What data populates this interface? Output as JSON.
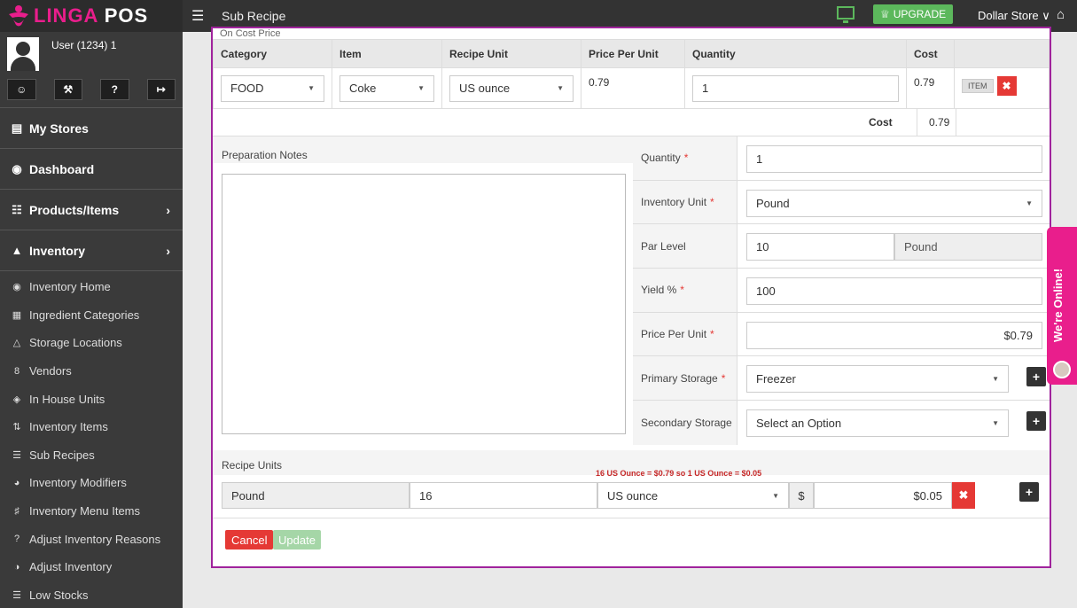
{
  "brand": {
    "logo_text_a": "LINGA",
    "logo_text_b": "POS"
  },
  "user": {
    "name": "User (1234) 1"
  },
  "user_icons": [
    "person-icon",
    "wrench-icon",
    "help-icon",
    "logout-icon"
  ],
  "nav": {
    "my_stores": "My Stores",
    "dashboard": "Dashboard",
    "products": "Products/Items",
    "inventory": "Inventory",
    "sub_items": [
      "Inventory Home",
      "Ingredient Categories",
      "Storage Locations",
      "Vendors",
      "In House Units",
      "Inventory Items",
      "Sub Recipes",
      "Inventory Modifiers",
      "Inventory Menu Items",
      "Adjust Inventory Reasons",
      "Adjust Inventory",
      "Low Stocks"
    ]
  },
  "topbar": {
    "title": "Sub Recipe",
    "upgrade": "UPGRADE",
    "store": "Dollar Store"
  },
  "cost_section": {
    "label": "On Cost Price",
    "headers": [
      "Category",
      "Item",
      "Recipe Unit",
      "Price Per Unit",
      "Quantity",
      "Cost"
    ],
    "row": {
      "category": "FOOD",
      "item": "Coke",
      "recipe_unit": "US ounce",
      "price_per_unit": "0.79",
      "quantity": "1",
      "cost": "0.79",
      "badge": "ITEM"
    },
    "total_label": "Cost",
    "total_value": "0.79"
  },
  "prep": {
    "label": "Preparation Notes"
  },
  "form": {
    "quantity_label": "Quantity",
    "quantity_value": "1",
    "inventory_unit_label": "Inventory Unit",
    "inventory_unit_value": "Pound",
    "par_level_label": "Par Level",
    "par_level_value": "10",
    "par_level_unit": "Pound",
    "yield_label": "Yield %",
    "yield_value": "100",
    "price_label": "Price Per Unit",
    "price_value": "$0.79",
    "primary_storage_label": "Primary Storage",
    "primary_storage_value": "Freezer",
    "secondary_storage_label": "Secondary Storage",
    "secondary_storage_value": "Select an Option"
  },
  "recipe_units": {
    "label": "Recipe Units",
    "note": "16 US Ounce = $0.79 so 1 US Ounce = $0.05",
    "unit": "Pound",
    "qty": "16",
    "to_unit": "US ounce",
    "currency": "$",
    "price": "$0.05"
  },
  "buttons": {
    "cancel": "Cancel",
    "update": "Update"
  },
  "chat": {
    "label": "We're Online!"
  },
  "colors": {
    "accent": "#e91e8c",
    "border": "#a0239c",
    "danger": "#e53935",
    "success": "#5cb85c"
  }
}
